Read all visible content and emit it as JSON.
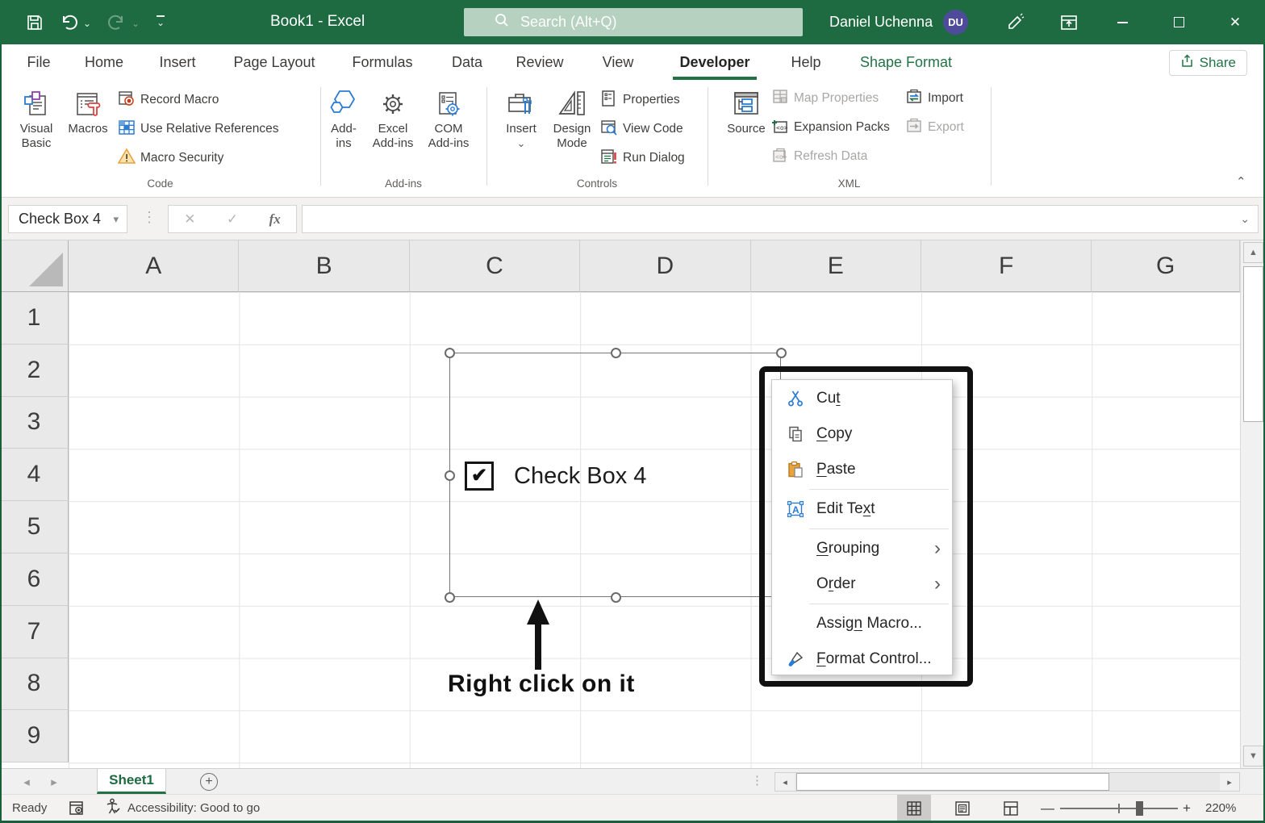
{
  "titlebar": {
    "title": "Book1  -  Excel",
    "search_placeholder": "Search (Alt+Q)",
    "user_name": "Daniel Uchenna",
    "user_initials": "DU"
  },
  "tabs": {
    "items": [
      "File",
      "Home",
      "Insert",
      "Page Layout",
      "Formulas",
      "Data",
      "Review",
      "View",
      "Developer",
      "Help",
      "Shape Format"
    ],
    "active": "Developer",
    "share": "Share"
  },
  "ribbon": {
    "groups": {
      "code": "Code",
      "addins": "Add-ins",
      "controls": "Controls",
      "xml": "XML"
    },
    "visual_basic": {
      "l1": "Visual",
      "l2": "Basic"
    },
    "macros": {
      "l1": "Macros",
      "l2": ""
    },
    "record_macro": "Record Macro",
    "use_relative_references": "Use Relative References",
    "macro_security": "Macro Security",
    "add_ins": {
      "l1": "Add-",
      "l2": "ins"
    },
    "excel_add_ins": {
      "l1": "Excel",
      "l2": "Add-ins"
    },
    "com_add_ins": {
      "l1": "COM",
      "l2": "Add-ins"
    },
    "insert": {
      "l1": "Insert",
      "l2": ""
    },
    "design_mode": {
      "l1": "Design",
      "l2": "Mode"
    },
    "properties": "Properties",
    "view_code": "View Code",
    "run_dialog": "Run Dialog",
    "source": {
      "l1": "Source",
      "l2": ""
    },
    "map_properties": "Map Properties",
    "expansion_packs": "Expansion Packs",
    "refresh_data": "Refresh Data",
    "import": "Import",
    "export": "Export"
  },
  "formula_bar": {
    "name_box": "Check Box 4",
    "formula_value": ""
  },
  "grid": {
    "columns": [
      "A",
      "B",
      "C",
      "D",
      "E",
      "F",
      "G"
    ],
    "rows": [
      "1",
      "2",
      "3",
      "4",
      "5",
      "6",
      "7",
      "8",
      "9"
    ]
  },
  "canvas": {
    "checkbox_label": "Check Box 4",
    "annotation": "Right click on it"
  },
  "context_menu": {
    "items": [
      {
        "pre": "Cu",
        "accel": "t",
        "suf": ""
      },
      {
        "pre": "",
        "accel": "C",
        "suf": "opy"
      },
      {
        "pre": "",
        "accel": "P",
        "suf": "aste"
      },
      {
        "pre": "Edit Te",
        "accel": "x",
        "suf": "t"
      },
      {
        "pre": "",
        "accel": "G",
        "suf": "rouping"
      },
      {
        "pre": "O",
        "accel": "r",
        "suf": "der"
      },
      {
        "pre": "Assig",
        "accel": "n",
        "suf": " Macro..."
      },
      {
        "pre": "",
        "accel": "F",
        "suf": "ormat Control..."
      }
    ]
  },
  "sheet_bar": {
    "sheet_name": "Sheet1"
  },
  "status_bar": {
    "ready": "Ready",
    "accessibility": "Accessibility: Good to go",
    "zoom_level": "220%"
  },
  "colors": {
    "titlebar_green": "#1e6b41",
    "accent_green": "#217346",
    "avatar_purple": "#4f4b9b",
    "annotation_black": "#111111"
  },
  "icons": {
    "name_box_caret": "▾",
    "cancel": "✕",
    "enter": "✓",
    "fx": "fx",
    "formula_expand": "⌄",
    "ribbon_collapse": "⌃",
    "insert_dropdown": "⌄",
    "qat_chevron": "⌄",
    "undo_chevron": "⌄",
    "redo_chevron": "⌄",
    "sheet_nav_left": "◂",
    "sheet_nav_right": "▸",
    "add_sheet": "+",
    "dots_vertical": "⋮",
    "scroll_left": "◂",
    "scroll_right": "▸",
    "scroll_up": "▲",
    "scroll_down": "▼",
    "minimize": "—",
    "close": "✕",
    "zoom_minus": "—",
    "zoom_plus": "+",
    "checkmark": "✔",
    "submenu_arrow": "›"
  }
}
